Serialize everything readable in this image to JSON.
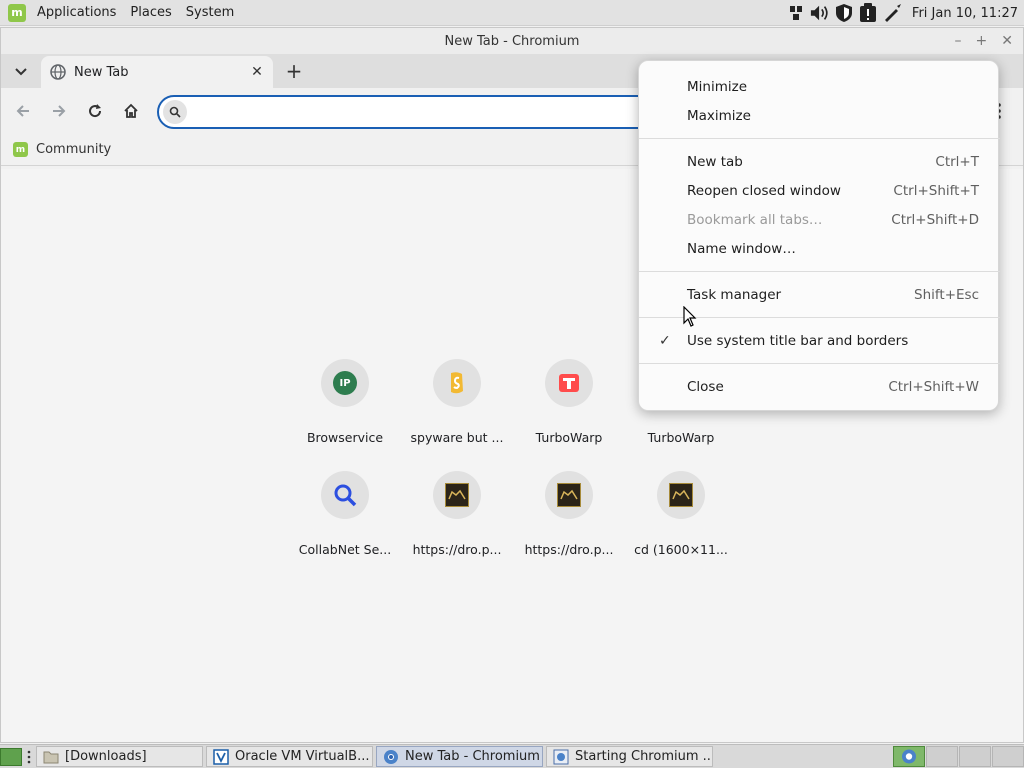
{
  "top_panel": {
    "menus": [
      "Applications",
      "Places",
      "System"
    ],
    "clock": "Fri Jan 10, 11:27",
    "tray_icons": [
      "network-icon",
      "volume-icon",
      "shield-icon",
      "update-icon",
      "pen-icon"
    ]
  },
  "window": {
    "title": "New Tab - Chromium"
  },
  "tabs": [
    {
      "title": "New Tab",
      "icon": "globe-icon"
    }
  ],
  "omnibox": {
    "value": "",
    "placeholder": ""
  },
  "bookmarks": [
    {
      "label": "Community",
      "icon": "mint-icon"
    }
  ],
  "shortcuts": [
    {
      "label": "Browservice",
      "icon": "ip-favicon"
    },
    {
      "label": "spyware but ...",
      "icon": "spyware-favicon"
    },
    {
      "label": "TurboWarp",
      "icon": "turbowarp-favicon"
    },
    {
      "label": "TurboWarp",
      "icon": "turbowarp-favicon"
    },
    {
      "label": "CollabNet Se...",
      "icon": "search-favicon"
    },
    {
      "label": "https://dro.p...",
      "icon": "image-favicon"
    },
    {
      "label": "https://dro.p...",
      "icon": "image-favicon"
    },
    {
      "label": "cd (1600×11...",
      "icon": "image-favicon"
    }
  ],
  "context_menu": {
    "items": [
      {
        "label": "Minimize",
        "accel": ""
      },
      {
        "label": "Maximize",
        "accel": ""
      },
      {
        "label": "New tab",
        "accel": "Ctrl+T"
      },
      {
        "label": "Reopen closed window",
        "accel": "Ctrl+Shift+T"
      },
      {
        "label": "Bookmark all tabs…",
        "accel": "Ctrl+Shift+D",
        "disabled": true
      },
      {
        "label": "Name window…",
        "accel": ""
      },
      {
        "label": "Task manager",
        "accel": "Shift+Esc"
      },
      {
        "label": "Use system title bar and borders",
        "accel": "",
        "checked": true
      },
      {
        "label": "Close",
        "accel": "Ctrl+Shift+W"
      }
    ]
  },
  "taskbar": {
    "buttons": [
      {
        "label": "[Downloads]",
        "icon": "folder-icon"
      },
      {
        "label": "Oracle VM VirtualB...",
        "icon": "virtualbox-icon"
      },
      {
        "label": "New Tab - Chromium",
        "icon": "chromium-icon",
        "active": true
      },
      {
        "label": "Starting Chromium ...",
        "icon": "app-icon"
      }
    ]
  },
  "colors": {
    "accent": "#1a5fb4",
    "mint_green": "#8fc74a"
  }
}
